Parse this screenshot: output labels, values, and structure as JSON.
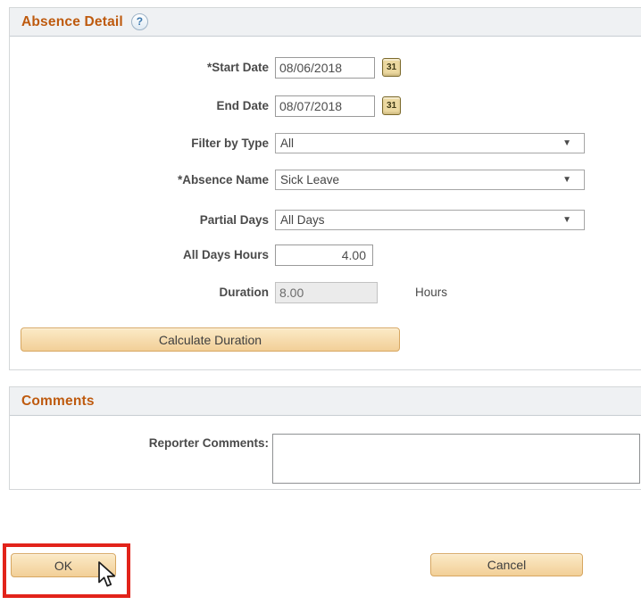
{
  "absence_detail": {
    "title": "Absence Detail",
    "help_icon": "?",
    "fields": {
      "start_date": {
        "label": "*Start Date",
        "value": "08/06/2018"
      },
      "end_date": {
        "label": "End Date",
        "value": "08/07/2018"
      },
      "filter_by_type": {
        "label": "Filter by Type",
        "value": "All"
      },
      "absence_name": {
        "label": "*Absence Name",
        "value": "Sick Leave"
      },
      "partial_days": {
        "label": "Partial Days",
        "value": "All Days"
      },
      "all_days_hours": {
        "label": "All Days Hours",
        "value": "4.00"
      },
      "duration": {
        "label": "Duration",
        "value": "8.00",
        "unit": "Hours"
      }
    },
    "calculate_button_label": "Calculate Duration"
  },
  "comments": {
    "title": "Comments",
    "reporter_comments_label": "Reporter Comments:",
    "reporter_comments_value": ""
  },
  "actions": {
    "ok_label": "OK",
    "cancel_label": "Cancel"
  },
  "icons": {
    "calendar": "31",
    "dropdown_arrow": "▼"
  },
  "colors": {
    "section_title": "#be5a0e",
    "button_face": "#f2cf97",
    "button_border": "#d7a761",
    "highlight_red": "#e2231a"
  }
}
